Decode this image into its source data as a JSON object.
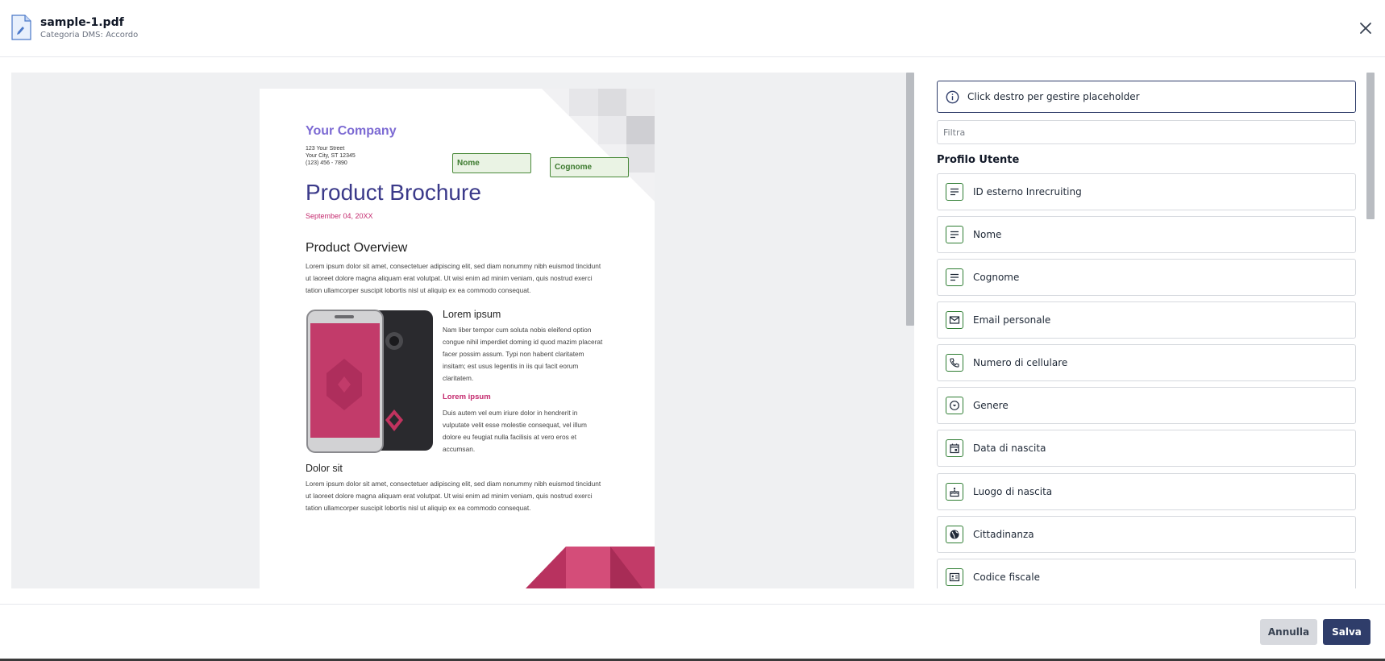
{
  "header": {
    "file_name": "sample-1.pdf",
    "category": "Categoria DMS: Accordo"
  },
  "document": {
    "company": "Your Company",
    "address": [
      "123 Your Street",
      "Your City, ST 12345",
      "(123) 456 - 7890"
    ],
    "title": "Product Brochure",
    "date": "September 04, 20XX",
    "overview_heading": "Product Overview",
    "overview_text": "Lorem ipsum dolor sit amet, consectetuer adipiscing elit, sed diam nonummy nibh euismod tincidunt ut laoreet dolore magna aliquam erat volutpat. Ut wisi enim ad minim veniam, quis nostrud exerci tation ullamcorper suscipit lobortis nisl ut aliquip ex ea commodo consequat.",
    "lorem_heading": "Lorem ipsum",
    "lorem_text": "Nam liber tempor cum soluta nobis eleifend option congue nihil imperdiet doming id quod mazim placerat facer possim assum. Typi non habent claritatem insitam; est usus legentis in iis qui facit eorum claritatem.",
    "lorem_sub": "Lorem ipsum",
    "lorem_sub_text": "Duis autem vel eum iriure dolor in hendrerit in vulputate velit esse molestie consequat, vel illum dolore eu feugiat nulla facilisis at vero eros et accumsan.",
    "dolor_heading": "Dolor sit",
    "dolor_text": "Lorem ipsum dolor sit amet, consectetuer adipiscing elit, sed diam nonummy nibh euismod tincidunt ut laoreet dolore magna aliquam erat volutpat. Ut wisi enim ad minim veniam, quis nostrud exerci tation ullamcorper suscipit lobortis nisl ut aliquip ex ea commodo consequat.",
    "placeholder_nome": "Nome",
    "placeholder_cognome": "Cognome"
  },
  "panel": {
    "info_text": "Click destro per gestire placeholder",
    "filter_placeholder": "Filtra",
    "section_title": "Profilo Utente",
    "fields": [
      {
        "label": "ID esterno Inrecruiting",
        "icon": "text-lines-icon"
      },
      {
        "label": "Nome",
        "icon": "text-lines-icon"
      },
      {
        "label": "Cognome",
        "icon": "text-lines-icon"
      },
      {
        "label": "Email personale",
        "icon": "mail-icon"
      },
      {
        "label": "Numero di cellulare",
        "icon": "phone-icon"
      },
      {
        "label": "Genere",
        "icon": "dropdown-circle-icon"
      },
      {
        "label": "Data di nascita",
        "icon": "calendar-icon"
      },
      {
        "label": "Luogo di nascita",
        "icon": "cake-icon"
      },
      {
        "label": "Cittadinanza",
        "icon": "globe-icon"
      },
      {
        "label": "Codice fiscale",
        "icon": "id-card-icon"
      }
    ]
  },
  "footer": {
    "cancel_label": "Annulla",
    "save_label": "Salva"
  },
  "colors": {
    "primary": "#2f3d6a",
    "field_icon": "#2e7d32",
    "accent_pink": "#c42a6e",
    "company_purple": "#7c6ad3"
  }
}
